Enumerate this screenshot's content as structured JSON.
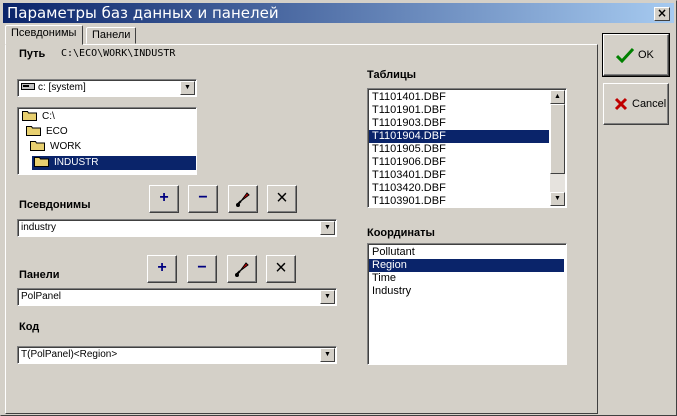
{
  "window": {
    "title": "Параметры баз данных и панелей",
    "close_label": "×"
  },
  "tabs": [
    {
      "label": "Псевдонимы"
    },
    {
      "label": "Панели"
    }
  ],
  "path": {
    "label": "Путь",
    "value": "C:\\ECO\\WORK\\INDUSTR"
  },
  "drive": {
    "value": "c: [system]"
  },
  "tree": {
    "items": [
      {
        "label": "C:\\"
      },
      {
        "label": "ECO"
      },
      {
        "label": "WORK"
      },
      {
        "label": "INDUSTR"
      }
    ]
  },
  "aliases": {
    "label": "Псевдонимы",
    "value": "industry"
  },
  "panels": {
    "label": "Панели",
    "value": "PolPanel"
  },
  "code": {
    "label": "Код",
    "value": "T(PolPanel)<Region>"
  },
  "toolbar": {
    "add": "+",
    "remove": "−",
    "delete": "×"
  },
  "tables": {
    "label": "Таблицы",
    "items": [
      "T1101401.DBF",
      "T1101901.DBF",
      "T1101903.DBF",
      "T1101904.DBF",
      "T1101905.DBF",
      "T1101906.DBF",
      "T1103401.DBF",
      "T1103420.DBF",
      "T1103901.DBF"
    ],
    "selected": "T1101904.DBF"
  },
  "coords": {
    "label": "Координаты",
    "items": [
      "Pollutant",
      "Region",
      "Time",
      "Industry"
    ],
    "selected": "Region"
  },
  "buttons": {
    "ok": "OK",
    "cancel": "Cancel"
  },
  "colors": {
    "selection": "#0a246a",
    "ok_check": "#008000",
    "cancel_x": "#c00000",
    "folder": "#e8d070"
  }
}
